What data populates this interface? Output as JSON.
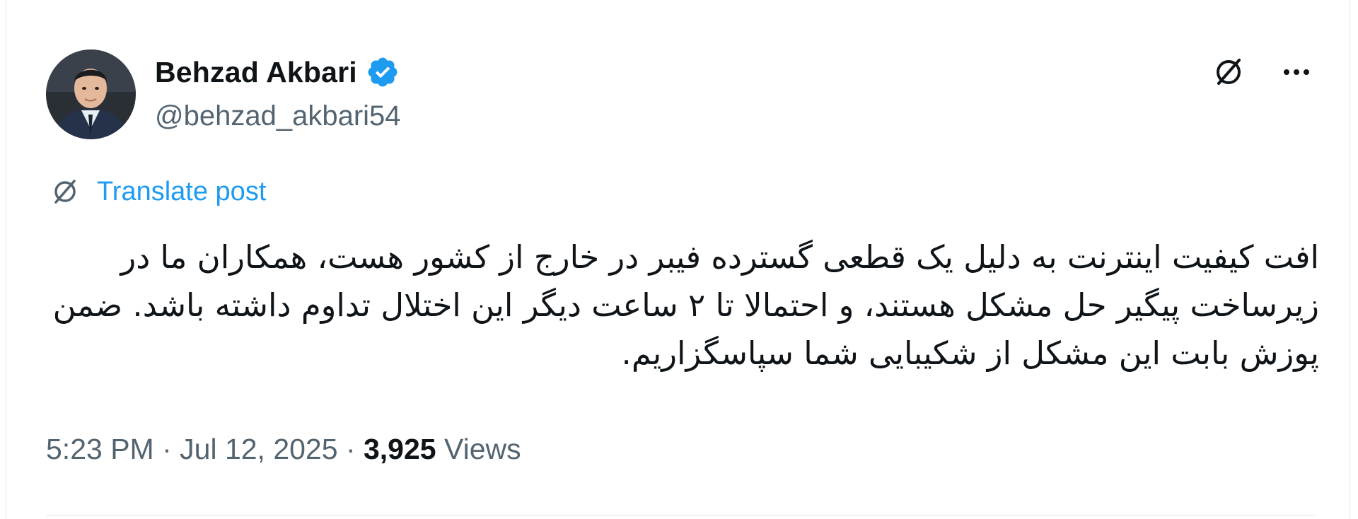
{
  "author": {
    "name": "Behzad Akbari",
    "handle": "@behzad_akbari54",
    "verified": true,
    "verified_color": "#1d9bf0"
  },
  "actions": {
    "grok_icon": "grok-icon",
    "more_icon": "more-icon"
  },
  "translate": {
    "label": "Translate post",
    "icon": "translate-icon"
  },
  "tweet": {
    "text": "افت کیفیت اینترنت به دلیل یک قطعی گسترده فیبر در خارج از کشور هست، همکاران ما در زیرساخت پیگیر حل مشکل هستند، و احتمالا تا ۲ ساعت دیگر این اختلال تداوم داشته باشد. ضمن پوزش بابت این مشکل از شکیبایی شما سپاسگزاریم."
  },
  "meta": {
    "time": "5:23 PM",
    "sep1": " · ",
    "date": "Jul 12, 2025",
    "sep2": " · ",
    "views_count": "3,925",
    "views_label": " Views"
  },
  "colors": {
    "text_primary": "#0f1419",
    "text_secondary": "#536471",
    "link": "#1d9bf0"
  }
}
